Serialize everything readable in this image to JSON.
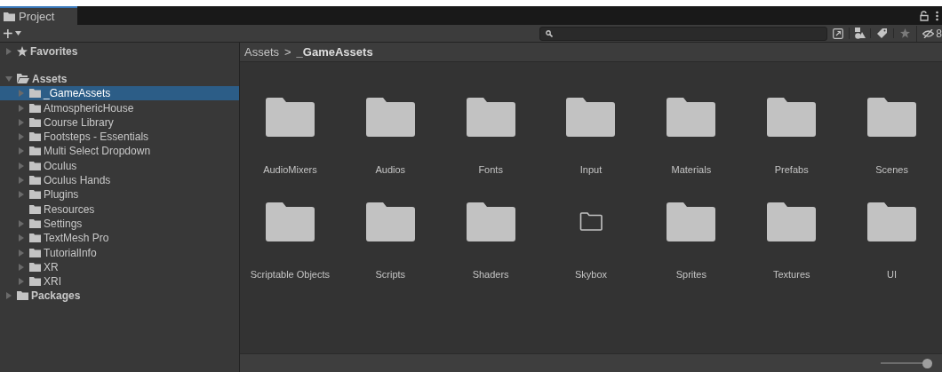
{
  "window": {
    "tab": "Project"
  },
  "toolbar": {
    "add_label": "+",
    "hidden_count": "8"
  },
  "sidebar": {
    "items": [
      {
        "label": "Favorites",
        "kind": "favorites",
        "expanded": false,
        "selected": false,
        "bold": true
      },
      {
        "label": "Assets",
        "kind": "folder",
        "expanded": true,
        "selected": false,
        "bold": true,
        "children": [
          {
            "label": "_GameAssets",
            "kind": "folder",
            "expanded": false,
            "selected": true
          },
          {
            "label": "AtmosphericHouse",
            "kind": "folder",
            "expanded": false,
            "selected": false
          },
          {
            "label": "Course Library",
            "kind": "folder",
            "expanded": false,
            "selected": false
          },
          {
            "label": "Footsteps - Essentials",
            "kind": "folder",
            "expanded": false,
            "selected": false
          },
          {
            "label": "Multi Select Dropdown",
            "kind": "folder",
            "expanded": false,
            "selected": false
          },
          {
            "label": "Oculus",
            "kind": "folder",
            "expanded": false,
            "selected": false
          },
          {
            "label": "Oculus Hands",
            "kind": "folder",
            "expanded": false,
            "selected": false
          },
          {
            "label": "Plugins",
            "kind": "folder",
            "expanded": false,
            "selected": false
          },
          {
            "label": "Resources",
            "kind": "leaf",
            "expanded": false,
            "selected": false
          },
          {
            "label": "Settings",
            "kind": "folder",
            "expanded": false,
            "selected": false
          },
          {
            "label": "TextMesh Pro",
            "kind": "folder",
            "expanded": false,
            "selected": false
          },
          {
            "label": "TutorialInfo",
            "kind": "folder",
            "expanded": false,
            "selected": false
          },
          {
            "label": "XR",
            "kind": "folder",
            "expanded": false,
            "selected": false
          },
          {
            "label": "XRI",
            "kind": "folder",
            "expanded": false,
            "selected": false
          }
        ]
      },
      {
        "label": "Packages",
        "kind": "folder",
        "expanded": false,
        "selected": false,
        "bold": true
      }
    ]
  },
  "breadcrumb": [
    "Assets",
    "_GameAssets"
  ],
  "breadcrumb_separator": ">",
  "grid": [
    {
      "label": "AudioMixers",
      "kind": "filled"
    },
    {
      "label": "Audios",
      "kind": "filled"
    },
    {
      "label": "Fonts",
      "kind": "filled"
    },
    {
      "label": "Input",
      "kind": "filled"
    },
    {
      "label": "Materials",
      "kind": "filled"
    },
    {
      "label": "Prefabs",
      "kind": "filled"
    },
    {
      "label": "Scenes",
      "kind": "filled"
    },
    {
      "label": "Scriptable Objects",
      "kind": "filled"
    },
    {
      "label": "Scripts",
      "kind": "filled"
    },
    {
      "label": "Shaders",
      "kind": "filled"
    },
    {
      "label": "Skybox",
      "kind": "empty"
    },
    {
      "label": "Sprites",
      "kind": "filled"
    },
    {
      "label": "Textures",
      "kind": "filled"
    },
    {
      "label": "UI",
      "kind": "filled"
    }
  ],
  "zoom_slider": {
    "level": 1
  }
}
